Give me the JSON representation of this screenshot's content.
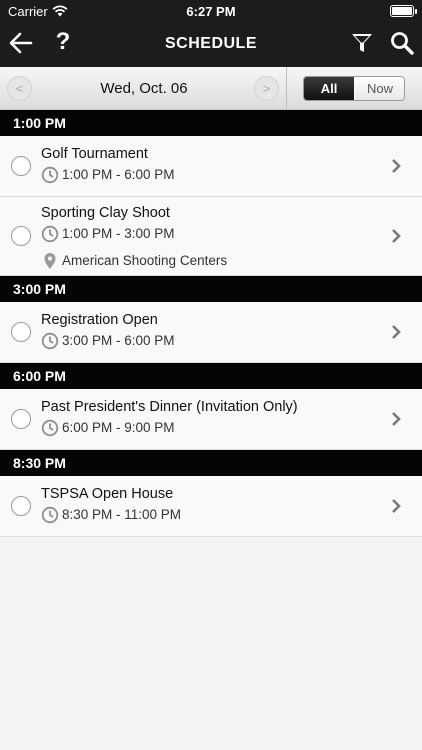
{
  "status": {
    "carrier": "Carrier",
    "time": "6:27 PM"
  },
  "nav": {
    "title": "SCHEDULE",
    "help": "?"
  },
  "datebar": {
    "date": "Wed, Oct. 06",
    "prev": "<",
    "next": ">",
    "filter_all": "All",
    "filter_now": "Now",
    "selected": "All"
  },
  "icons": {
    "back": "arrow-left-icon",
    "filter": "funnel-icon",
    "search": "search-icon",
    "time": "clock-icon",
    "location": "map-pin-icon",
    "chevron": "chevron-right-icon"
  },
  "colors": {
    "nav_bg": "#1c1c1c",
    "header_bg": "#050505",
    "row_bg": "#f9f9f9"
  },
  "groups": [
    {
      "time": "1:00 PM",
      "events": [
        {
          "name": "Golf Tournament",
          "time": "1:00 PM - 6:00 PM",
          "location": ""
        },
        {
          "name": "Sporting Clay Shoot",
          "time": "1:00 PM - 3:00 PM",
          "location": "American Shooting Centers"
        }
      ]
    },
    {
      "time": "3:00 PM",
      "events": [
        {
          "name": "Registration Open",
          "time": "3:00 PM - 6:00 PM",
          "location": ""
        }
      ]
    },
    {
      "time": "6:00 PM",
      "events": [
        {
          "name": "Past President's Dinner (Invitation Only)",
          "time": "6:00 PM - 9:00 PM",
          "location": ""
        }
      ]
    },
    {
      "time": "8:30 PM",
      "events": [
        {
          "name": "TSPSA Open House",
          "time": "8:30 PM - 11:00 PM",
          "location": ""
        }
      ]
    }
  ]
}
